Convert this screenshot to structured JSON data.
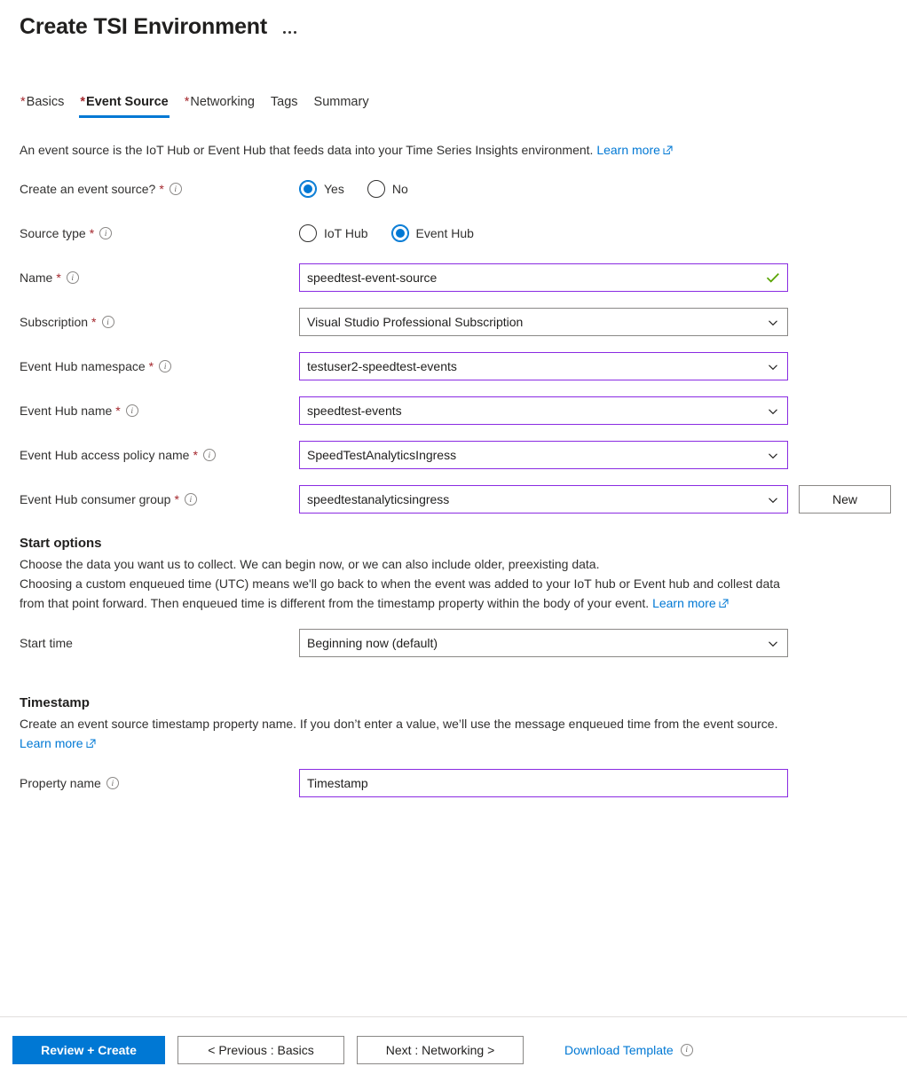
{
  "header": {
    "title": "Create TSI Environment",
    "menu_icon": "ellipsis-icon"
  },
  "tabs": [
    {
      "label": "Basics",
      "required": true,
      "active": false
    },
    {
      "label": "Event Source",
      "required": true,
      "active": true
    },
    {
      "label": "Networking",
      "required": true,
      "active": false
    },
    {
      "label": "Tags",
      "required": false,
      "active": false
    },
    {
      "label": "Summary",
      "required": false,
      "active": false
    }
  ],
  "intro": {
    "text": "An event source is the IoT Hub or Event Hub that feeds data into your Time Series Insights environment.",
    "link": "Learn more",
    "link_icon": "external-link-icon"
  },
  "radios": {
    "create_event_source": {
      "label": "Create an event source?",
      "required": true,
      "info_icon": "info-icon",
      "options": [
        {
          "label": "Yes",
          "checked": true
        },
        {
          "label": "No",
          "checked": false
        }
      ]
    },
    "source_type": {
      "label": "Source type",
      "required": true,
      "info_icon": "info-icon",
      "options": [
        {
          "label": "IoT Hub",
          "checked": false
        },
        {
          "label": "Event Hub",
          "checked": true
        }
      ]
    }
  },
  "fields": [
    {
      "label": "Name",
      "required": true,
      "info_icon": "info-icon",
      "value": "speedtest-event-source",
      "control": "text",
      "border": "purple",
      "trailing_icon": "checkmark-icon"
    },
    {
      "label": "Subscription",
      "required": true,
      "info_icon": "info-icon",
      "value": "Visual Studio Professional Subscription",
      "control": "dropdown",
      "border": "gray",
      "trailing_icon": "chevron-down-icon"
    },
    {
      "label": "Event Hub namespace",
      "required": true,
      "info_icon": "info-icon",
      "value": "testuser2-speedtest-events",
      "control": "dropdown",
      "border": "purple",
      "trailing_icon": "chevron-down-icon"
    },
    {
      "label": "Event Hub name",
      "required": true,
      "info_icon": "info-icon",
      "value": "speedtest-events",
      "control": "dropdown",
      "border": "purple",
      "trailing_icon": "chevron-down-icon"
    },
    {
      "label": "Event Hub access policy name",
      "required": true,
      "info_icon": "info-icon",
      "value": "SpeedTestAnalyticsIngress",
      "control": "dropdown",
      "border": "purple",
      "trailing_icon": "chevron-down-icon"
    },
    {
      "label": "Event Hub consumer group",
      "required": true,
      "info_icon": "info-icon",
      "value": "speedtestanalyticsingress",
      "control": "dropdown",
      "border": "purple",
      "trailing_icon": "chevron-down-icon",
      "side_button": "New"
    }
  ],
  "start_options": {
    "title": "Start options",
    "desc_line1": "Choose the data you want us to collect. We can begin now, or we can also include older, preexisting data.",
    "desc_line2": "Choosing a custom enqueued time (UTC) means we'll go back to when the event was added to your IoT hub or Event hub and collest data from that point forward. Then enqueued time is different from the timestamp property within the body of your event.",
    "link": "Learn more",
    "start_time_label": "Start time",
    "start_time_value": "Beginning now (default)"
  },
  "timestamp": {
    "title": "Timestamp",
    "desc": "Create an event source timestamp property name. If you don’t enter a value, we’ll use the message enqueued time from the event source.",
    "link": "Learn more",
    "property_label": "Property name",
    "property_value": "Timestamp"
  },
  "footer": {
    "review_create": "Review + Create",
    "previous": "< Previous : Basics",
    "next": "Next : Networking >",
    "download_template": "Download Template",
    "download_info_icon": "info-icon"
  },
  "colors": {
    "accent": "#0078d4",
    "required_star": "#a4262c",
    "field_border_active": "#8a2be2",
    "field_border_default": "#8a8886",
    "success": "#57a300"
  }
}
